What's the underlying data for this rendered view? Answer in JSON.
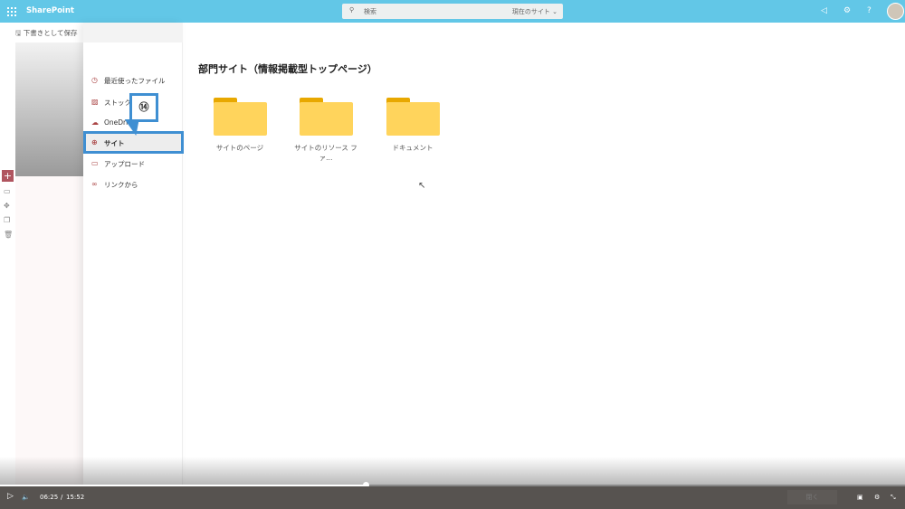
{
  "header": {
    "brand": "SharePoint",
    "search_placeholder": "検索",
    "search_scope": "現在のサイト",
    "icons": [
      "waffle-icon",
      "search-icon",
      "megaphone-icon",
      "gear-icon",
      "help-icon",
      "avatar"
    ]
  },
  "toolbar": {
    "save_label": "下書きとして保存"
  },
  "picker": {
    "items": [
      {
        "label": "最近使ったファイル",
        "icon": "clock-icon"
      },
      {
        "label": "ストック",
        "icon": "image-icon"
      },
      {
        "label": "OneDrive",
        "icon": "cloud-icon"
      },
      {
        "label": "サイト",
        "icon": "globe-icon",
        "selected": true
      },
      {
        "label": "アップロード",
        "icon": "laptop-icon"
      },
      {
        "label": "リンクから",
        "icon": "link-icon"
      }
    ]
  },
  "annotation": {
    "label": "⑭",
    "color": "#3f8fd2"
  },
  "main": {
    "title": "部門サイト（情報掲載型トップページ）",
    "folders": [
      "サイトのページ",
      "サイトのリソース ファ...",
      "ドキュメント"
    ]
  },
  "video": {
    "current": "06:25",
    "separator": "/",
    "duration": "15:52",
    "progress_percent": 40.4,
    "close_label": "閉く"
  },
  "colors": {
    "header": "#62c7e7",
    "accent": "#b0555f",
    "folder": "#ffd45c"
  }
}
